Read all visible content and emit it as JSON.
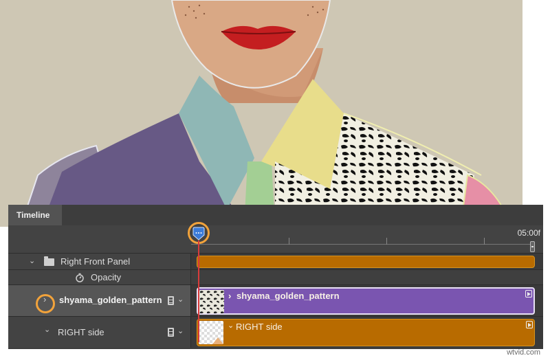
{
  "panel": {
    "tab_label": "Timeline",
    "end_time": "05:00f"
  },
  "tracks": {
    "folder": {
      "name": "Right Front Panel",
      "icon": "folder-icon"
    },
    "opacity": {
      "name": "Opacity",
      "icon": "stopwatch-icon"
    },
    "pattern": {
      "name": "shyama_golden_pattern",
      "clip_title": "shyama_golden_pattern",
      "clip_color": "#7a55b0"
    },
    "right_side": {
      "name": "RIGHT side",
      "clip_title": "RIGHT side",
      "clip_color": "#b86b00"
    }
  },
  "accent": {
    "highlight": "#f2a33b",
    "playhead": "#d93b3b"
  },
  "watermark": "wtvid.com"
}
